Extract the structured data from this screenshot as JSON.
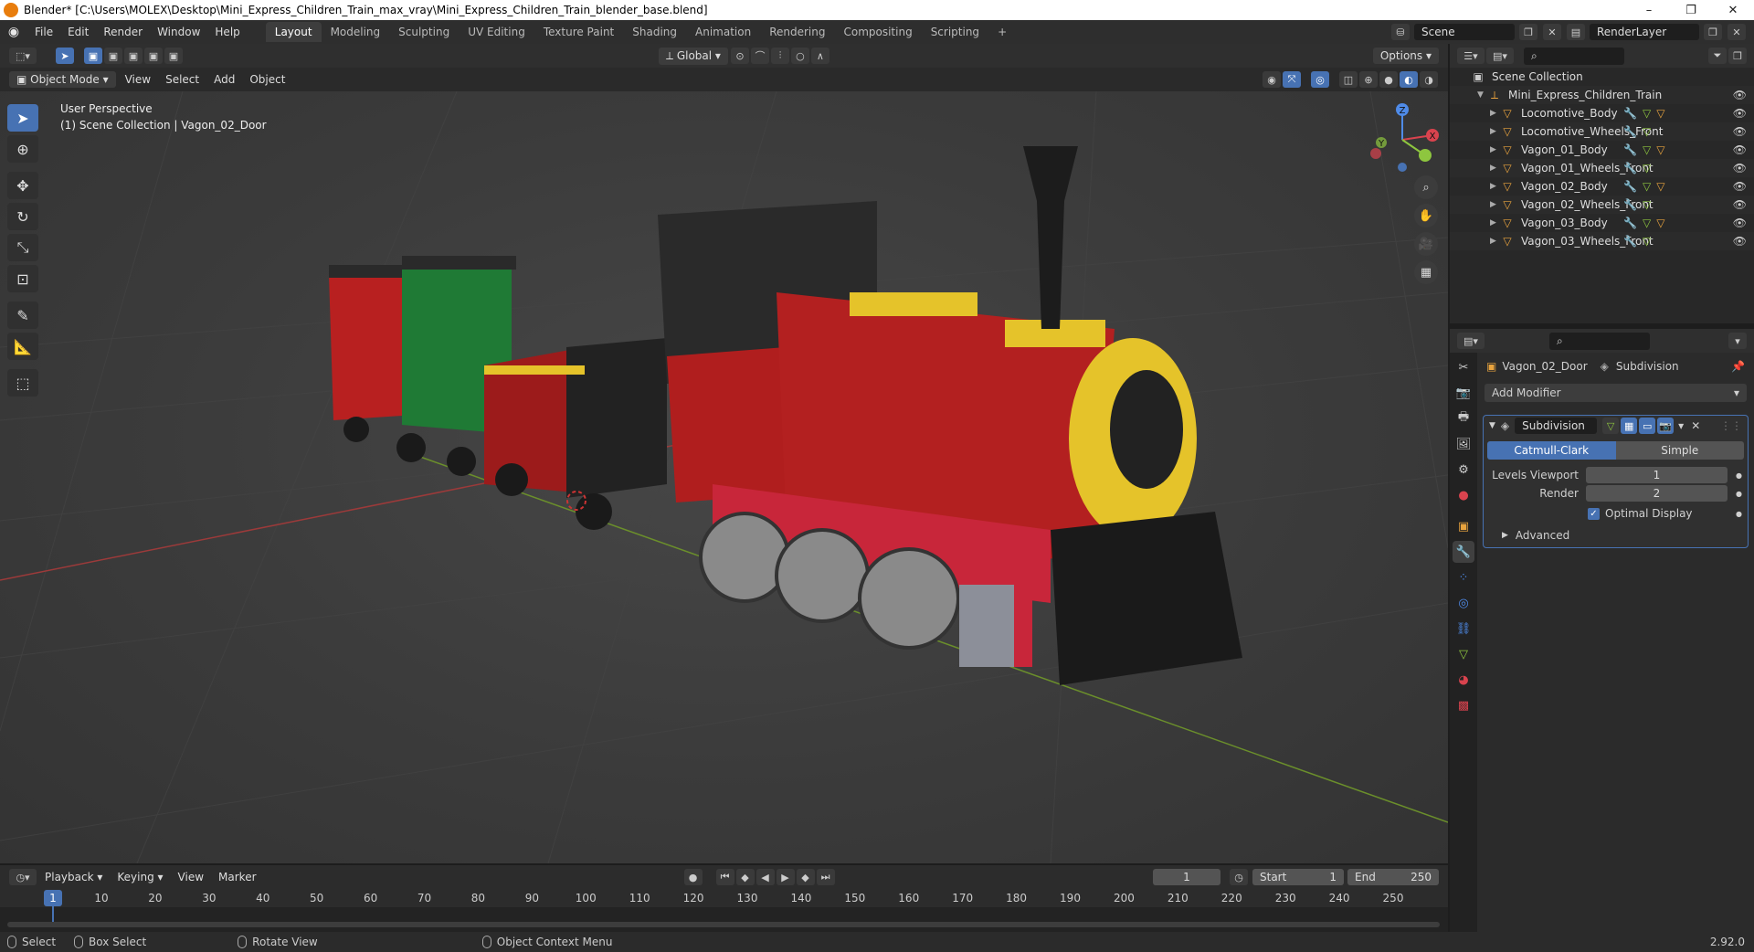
{
  "window": {
    "title": "Blender* [C:\\Users\\MOLEX\\Desktop\\Mini_Express_Children_Train_max_vray\\Mini_Express_Children_Train_blender_base.blend]",
    "minimize": "–",
    "maximize": "❐",
    "close": "✕"
  },
  "menu": [
    "File",
    "Edit",
    "Render",
    "Window",
    "Help"
  ],
  "workspaces": [
    "Layout",
    "Modeling",
    "Sculpting",
    "UV Editing",
    "Texture Paint",
    "Shading",
    "Animation",
    "Rendering",
    "Compositing",
    "Scripting"
  ],
  "workspace_add": "+",
  "scene": {
    "name": "Scene",
    "render_layer": "RenderLayer"
  },
  "viewport": {
    "mode": "Object Mode",
    "menus": [
      "View",
      "Select",
      "Add",
      "Object"
    ],
    "transform_orientation": "Global",
    "options": "Options",
    "perspective": "User Perspective",
    "collection_info": "(1) Scene Collection | Vagon_02_Door",
    "gizmo": {
      "x": "X",
      "y": "Y",
      "z": "Z"
    }
  },
  "outliner": {
    "root": "Scene Collection",
    "collection": "Mini_Express_Children_Train",
    "items": [
      {
        "name": "Locomotive_Body"
      },
      {
        "name": "Locomotive_Wheels_Front"
      },
      {
        "name": "Vagon_01_Body"
      },
      {
        "name": "Vagon_01_Wheels_Front"
      },
      {
        "name": "Vagon_02_Body"
      },
      {
        "name": "Vagon_02_Wheels_Front"
      },
      {
        "name": "Vagon_03_Body"
      },
      {
        "name": "Vagon_03_Wheels_Front"
      }
    ]
  },
  "properties": {
    "object": "Vagon_02_Door",
    "modifier_context": "Subdivision",
    "add_modifier": "Add Modifier",
    "modifier": {
      "name": "Subdivision",
      "method_a": "Catmull-Clark",
      "method_b": "Simple",
      "levels_viewport_label": "Levels Viewport",
      "levels_viewport": "1",
      "render_label": "Render",
      "render": "2",
      "optimal_display": "Optimal Display",
      "advanced": "Advanced"
    }
  },
  "timeline": {
    "menus": [
      "Playback",
      "Keying",
      "View",
      "Marker"
    ],
    "current_frame": "1",
    "start_label": "Start",
    "start": "1",
    "end_label": "End",
    "end": "250",
    "ticks": [
      "1",
      "10",
      "20",
      "30",
      "40",
      "50",
      "60",
      "70",
      "80",
      "90",
      "100",
      "110",
      "120",
      "130",
      "140",
      "150",
      "160",
      "170",
      "180",
      "190",
      "200",
      "210",
      "220",
      "230",
      "240",
      "250"
    ]
  },
  "status": {
    "select": "Select",
    "box_select": "Box Select",
    "rotate_view": "Rotate View",
    "context_menu": "Object Context Menu",
    "version": "2.92.0"
  },
  "colors": {
    "accent": "#4772b3",
    "x_axis": "#d9434e",
    "y_axis": "#8ec63f",
    "z_axis": "#4f8be8"
  }
}
